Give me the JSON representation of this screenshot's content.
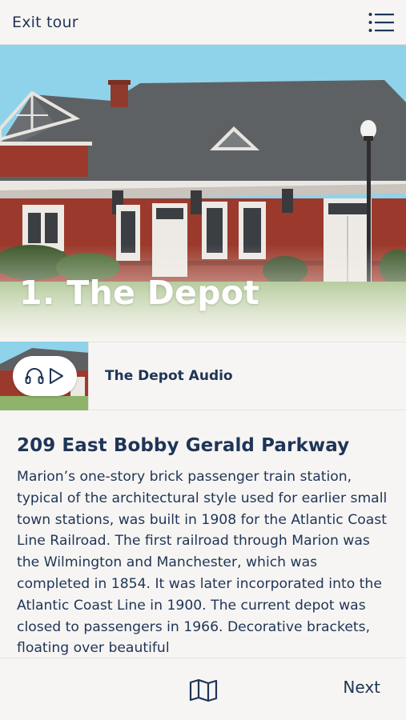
{
  "header": {
    "exit_label": "Exit tour",
    "menu_icon": "list-menu-icon"
  },
  "hero": {
    "title": "1. The Depot"
  },
  "audio": {
    "title": "The Depot Audio",
    "icons": [
      "headphones-icon",
      "play-icon"
    ]
  },
  "stop": {
    "address": "209 East Bobby Gerald Parkway",
    "description": "Marion’s one-story brick passenger train station, typical of the architectural style used for earlier small town stations, was built in 1908 for the Atlantic Coast Line Railroad. The first railroad through Marion was the Wilmington and Manchester, which was completed in 1854. It was later incorporated into the Atlantic Coast Line in 1900. The current depot was closed to passengers in 1966. Decorative brackets, floating over beautiful"
  },
  "footer": {
    "map_icon": "map-icon",
    "next_label": "Next"
  },
  "colors": {
    "text": "#1e3557",
    "background": "#f7f5f3",
    "brick": "#9b3a2c",
    "roof": "#5e6164",
    "sky": "#8fd3ea"
  }
}
